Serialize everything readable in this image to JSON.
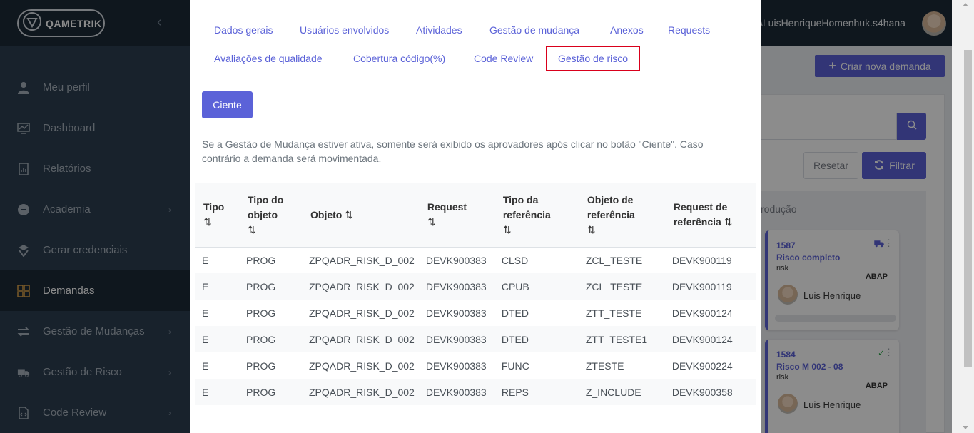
{
  "sidebar": {
    "logo": "QAMETRIK",
    "items": [
      {
        "label": "Meu perfil",
        "icon": "user-icon",
        "chevron": false
      },
      {
        "label": "Dashboard",
        "icon": "dashboard-icon",
        "chevron": false
      },
      {
        "label": "Relatórios",
        "icon": "report-icon",
        "chevron": false
      },
      {
        "label": "Academia",
        "icon": "academy-icon",
        "chevron": true
      },
      {
        "label": "Gerar credenciais",
        "icon": "credentials-icon",
        "chevron": false
      },
      {
        "label": "Demandas",
        "icon": "grid-icon",
        "chevron": false,
        "active": true
      },
      {
        "label": "Gestão de Mudanças",
        "icon": "exchange-icon",
        "chevron": true
      },
      {
        "label": "Gestão de Risco",
        "icon": "truck-icon",
        "chevron": true
      },
      {
        "label": "Code Review",
        "icon": "file-code-icon",
        "chevron": true
      }
    ]
  },
  "header": {
    "user_path": "\\LuisHenriqueHomenhuk.s4hana"
  },
  "background": {
    "create_button": "Criar nova demanda",
    "reset_button": "Resetar",
    "filter_button": "Filtrar",
    "column_label": "rodução",
    "cards": [
      {
        "id": "1587",
        "title": "Risco completo",
        "subtitle": "risk",
        "tag": "ABAP",
        "user": "Luis Henrique",
        "status_icon": "truck-icon"
      },
      {
        "id": "1584",
        "title": "Risco M 002 - 08",
        "subtitle": "risk",
        "tag": "ABAP",
        "user": "Luis Henrique",
        "status_icon": "check-icon"
      }
    ]
  },
  "modal": {
    "tabs": [
      {
        "label": "Dados gerais"
      },
      {
        "label": "Usuários envolvidos"
      },
      {
        "label": "Atividades"
      },
      {
        "label": "Gestão de mudança"
      },
      {
        "label": "Anexos"
      },
      {
        "label": "Requests"
      },
      {
        "label": "Avaliações de qualidade"
      },
      {
        "label": "Cobertura código(%)"
      },
      {
        "label": "Code Review"
      },
      {
        "label": "Gestão de risco",
        "active": true
      }
    ],
    "ack_button": "Ciente",
    "info_text": "Se a Gestão de Mudança estiver ativa, somente será exibido os aprovadores após clicar no botão \"Ciente\". Caso contrário a demanda será movimentada.",
    "table": {
      "headers": [
        "Tipo",
        "Tipo do objeto",
        "Objeto",
        "Request",
        "Tipo da referência",
        "Objeto de referência",
        "Request de referência"
      ],
      "sort_glyph": "⇅",
      "rows": [
        [
          "E",
          "PROG",
          "ZPQADR_RISK_D_002",
          "DEVK900383",
          "CLSD",
          "ZCL_TESTE",
          "DEVK900119"
        ],
        [
          "E",
          "PROG",
          "ZPQADR_RISK_D_002",
          "DEVK900383",
          "CPUB",
          "ZCL_TESTE",
          "DEVK900119"
        ],
        [
          "E",
          "PROG",
          "ZPQADR_RISK_D_002",
          "DEVK900383",
          "DTED",
          "ZTT_TESTE",
          "DEVK900124"
        ],
        [
          "E",
          "PROG",
          "ZPQADR_RISK_D_002",
          "DEVK900383",
          "DTED",
          "ZTT_TESTE1",
          "DEVK900124"
        ],
        [
          "E",
          "PROG",
          "ZPQADR_RISK_D_002",
          "DEVK900383",
          "FUNC",
          "ZTESTE",
          "DEVK900224"
        ],
        [
          "E",
          "PROG",
          "ZPQADR_RISK_D_002",
          "DEVK900383",
          "REPS",
          "Z_INCLUDE",
          "DEVK900358"
        ]
      ]
    }
  },
  "colors": {
    "accent": "#5b62d8",
    "sidebar_bg": "#2c3e50",
    "highlight_border": "#d9001b"
  }
}
